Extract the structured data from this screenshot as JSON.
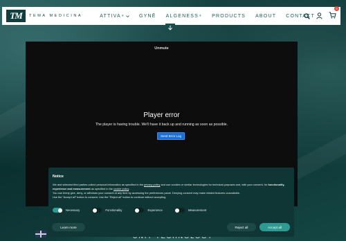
{
  "brand": {
    "mark": "TM",
    "name": "TEMA MEDICINA"
  },
  "nav": {
    "items": [
      {
        "label": "ATTIVA",
        "sup": "®",
        "has_dropdown": true
      },
      {
        "label": "GYNĒ",
        "sup": "",
        "has_dropdown": false
      },
      {
        "label": "ALGENESS",
        "sup": "®",
        "has_dropdown": false
      },
      {
        "label": "PRODUCTS",
        "sup": "",
        "has_dropdown": false
      },
      {
        "label": "ABOUT",
        "sup": "",
        "has_dropdown": false
      },
      {
        "label": "CONTACT",
        "sup": "",
        "has_dropdown": false
      }
    ],
    "icons": [
      "search-icon",
      "user-icon",
      "cart-icon"
    ],
    "cart_count": "0"
  },
  "player": {
    "unmute": "Unmute",
    "error_title": "Player error",
    "error_message": "The player is having trouble. We'll have it back up and running as soon as possible.",
    "error_button": "Send Error Log"
  },
  "cookie_notice": {
    "title": "Notice",
    "text_part1": "We and selected third parties collect personal information as specified in the ",
    "privacy_link": "privacy policy",
    "text_part2": " and use cookies or similar technologies for technical purposes and, with your consent, for ",
    "purposes_bold": "functionality, experience and measurement",
    "text_part3": " as specified in the ",
    "cookie_link": "cookie policy",
    "text_part4": ".",
    "line2": "You can freely give, deny, or withdraw your consent at any time by accessing the preferences panel. Denying consent may make related features unavailable.",
    "line3": "Use the “Accept all” button to consent. Use the “Reject all” button to continue without accepting.",
    "toggles": [
      {
        "label": "Necessary",
        "on": true
      },
      {
        "label": "Functionality",
        "on": false
      },
      {
        "label": "Experience",
        "on": false
      },
      {
        "label": "Measurement",
        "on": false
      }
    ],
    "learn_more": "Learn more",
    "reject_all": "Reject all",
    "accept_all": "Accept all"
  },
  "page_heading_peek": "UNIT TECHNOLOGY",
  "colors": {
    "brand_teal": "#123f3e",
    "accent_teal": "#2e9a92",
    "player_button": "#1a6fd6",
    "badge_red": "#e04a3a"
  }
}
